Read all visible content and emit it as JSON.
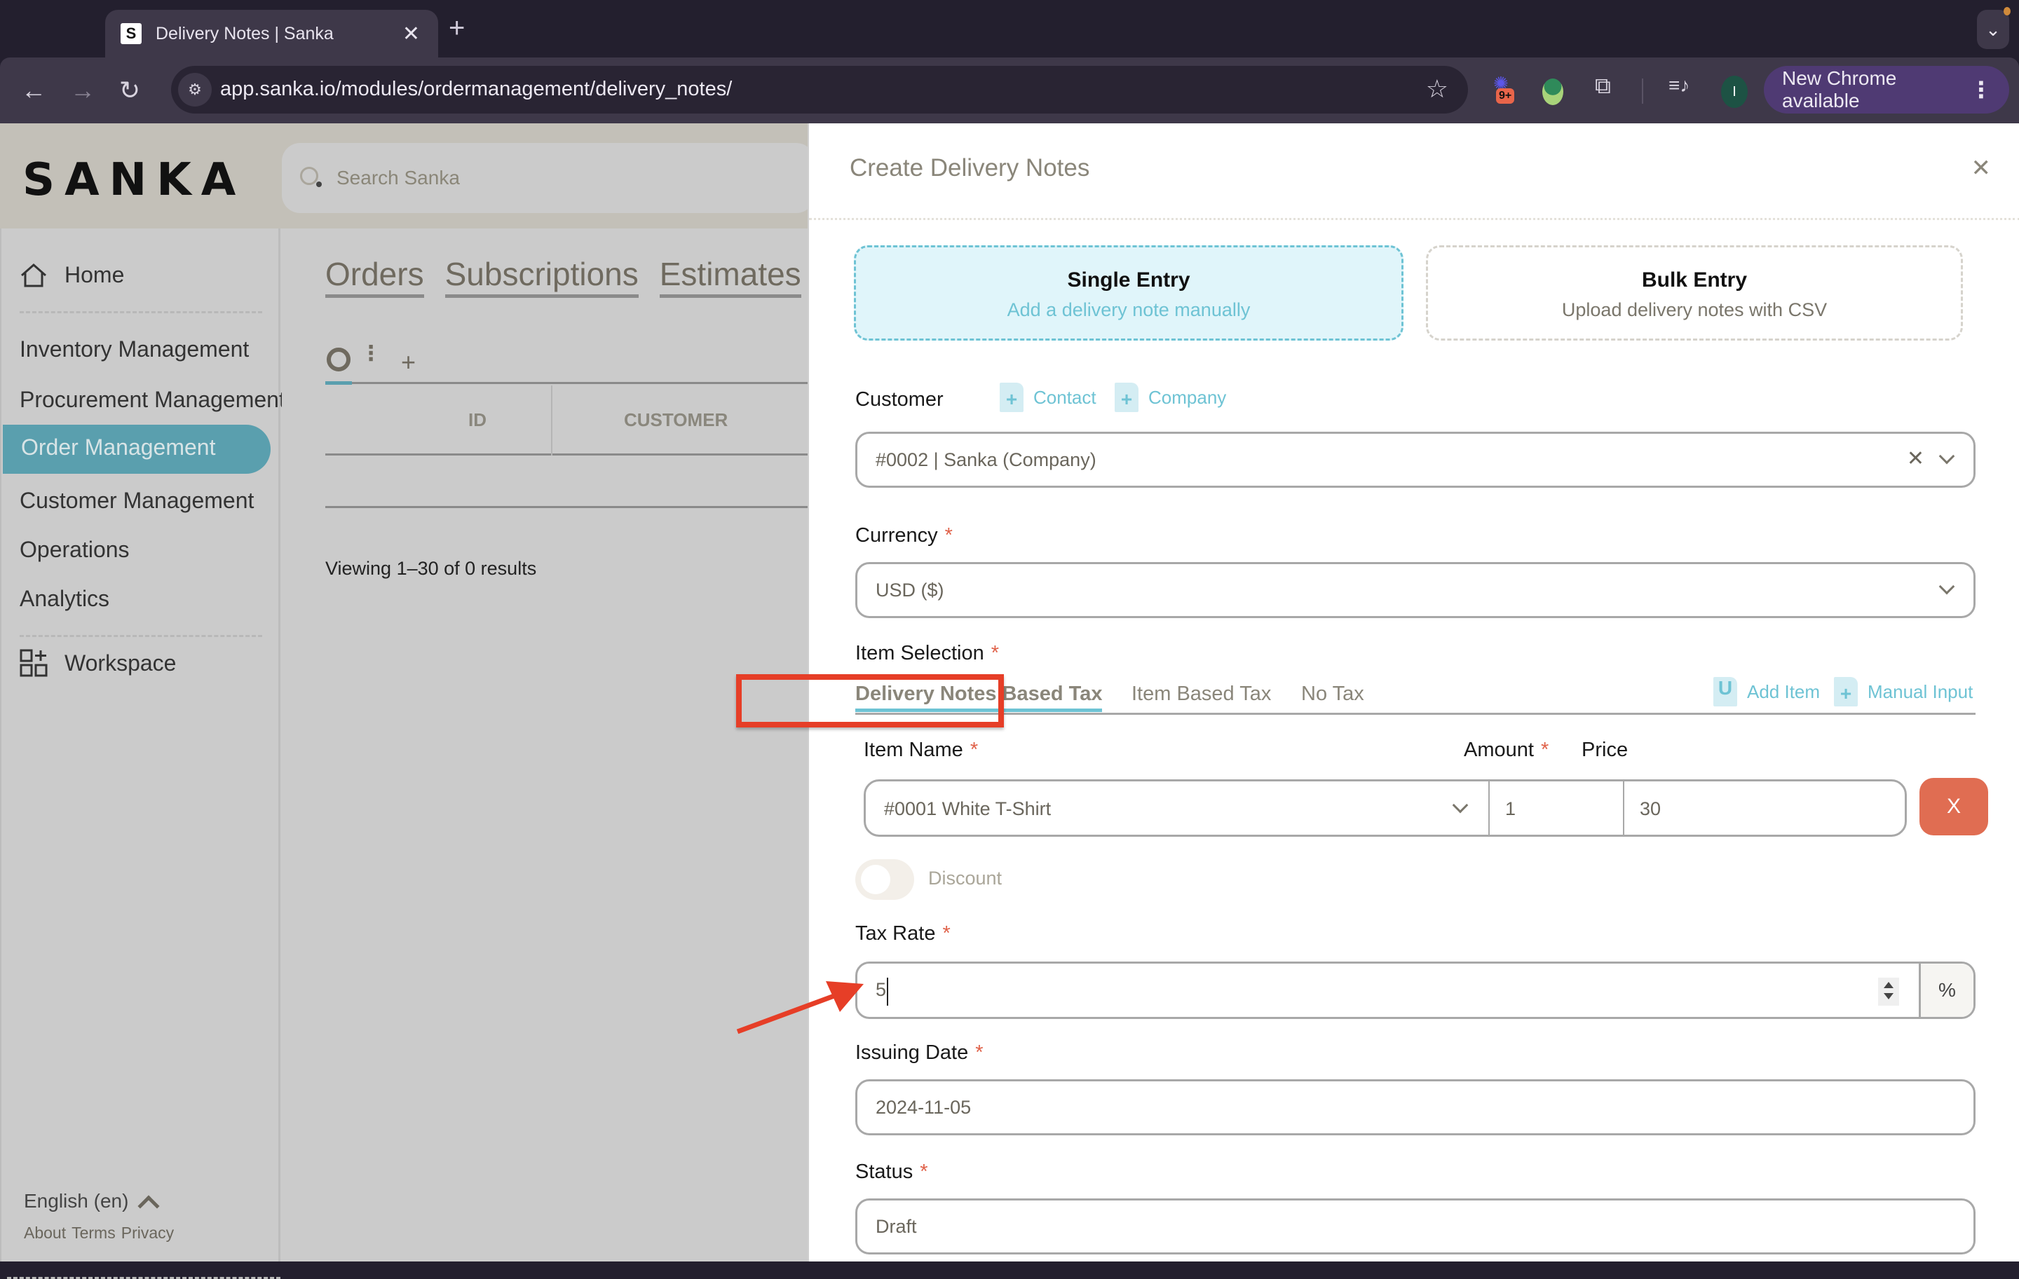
{
  "browser": {
    "tab_title": "Delivery Notes | Sanka",
    "tab_favicon": "S",
    "url": "app.sanka.io/modules/ordermanagement/delivery_notes/",
    "extension_badge": "9+",
    "profile_initial": "I",
    "update_label": "New Chrome available"
  },
  "app": {
    "logo": "SANKA",
    "search_placeholder": "Search Sanka",
    "sidebar": {
      "home": "Home",
      "items": [
        {
          "label": "Inventory Management"
        },
        {
          "label": "Procurement Management"
        },
        {
          "label": "Order Management",
          "active": true
        },
        {
          "label": "Customer Management"
        },
        {
          "label": "Operations"
        },
        {
          "label": "Analytics"
        }
      ],
      "workspace": "Workspace",
      "language": "English (en)",
      "legal": [
        "About",
        "Terms",
        "Privacy"
      ]
    },
    "main": {
      "tabs": [
        "Orders",
        "Subscriptions",
        "Estimates"
      ],
      "columns": [
        "ID",
        "CUSTOMER"
      ],
      "results_text": "Viewing 1–30 of 0 results"
    }
  },
  "panel": {
    "title": "Create Delivery Notes",
    "entry_modes": [
      {
        "title": "Single Entry",
        "subtitle": "Add a delivery note manually",
        "selected": true
      },
      {
        "title": "Bulk Entry",
        "subtitle": "Upload delivery notes with CSV",
        "selected": false
      }
    ],
    "customer": {
      "label": "Customer",
      "add_contact": "Contact",
      "add_company": "Company",
      "value": "#0002 | Sanka (Company)"
    },
    "currency": {
      "label": "Currency",
      "value": "USD ($)"
    },
    "item_selection": {
      "label": "Item Selection",
      "tax_tabs": [
        "Delivery Notes Based Tax",
        "Item Based Tax",
        "No Tax"
      ],
      "active_tab": "Delivery Notes Based Tax",
      "add_item": "Add Item",
      "manual_input": "Manual Input",
      "col_item_name": "Item Name",
      "col_amount": "Amount",
      "col_price": "Price",
      "rows": [
        {
          "item": "#0001 White T-Shirt",
          "amount": "1",
          "price": "30"
        }
      ],
      "delete_label": "X"
    },
    "discount_label": "Discount",
    "discount_enabled": false,
    "tax_rate": {
      "label": "Tax Rate",
      "value": "5",
      "suffix": "%"
    },
    "issuing_date": {
      "label": "Issuing Date",
      "value": "2024-11-05"
    },
    "status": {
      "label": "Status",
      "value": "Draft"
    },
    "required_marker": "*"
  },
  "colors": {
    "accent": "#6ec3d4",
    "sidebar_active": "#5a9fae",
    "danger": "#e06d52",
    "annotation": "#e63e27"
  }
}
